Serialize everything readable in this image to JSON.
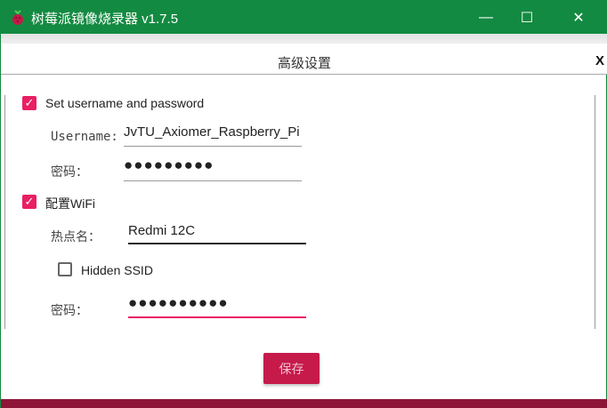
{
  "window": {
    "title": "树莓派镜像烧录器 v1.7.5",
    "minimize": "—",
    "maximize": "☐",
    "close": "✕"
  },
  "dialog": {
    "title": "高级设置",
    "close": "X"
  },
  "user": {
    "checkbox_label": "Set username and password",
    "checked": true,
    "username_label": "Username:",
    "username_value": "JvTU_Axiomer_Raspberry_Pi",
    "password_label": "密码：",
    "password_value": "●●●●●●●●●"
  },
  "wifi": {
    "checkbox_label": "配置WiFi",
    "checked": true,
    "ssid_label": "热点名：",
    "ssid_value": "Redmi 12C",
    "hidden_label": "Hidden SSID",
    "hidden_checked": false,
    "password_label": "密码：",
    "password_value": "●●●●●●●●●●"
  },
  "save_label": "保存",
  "colors": {
    "titlebar": "#138a41",
    "accent": "#e91e63",
    "button": "#c51a4a",
    "bottombar": "#8e1537"
  }
}
